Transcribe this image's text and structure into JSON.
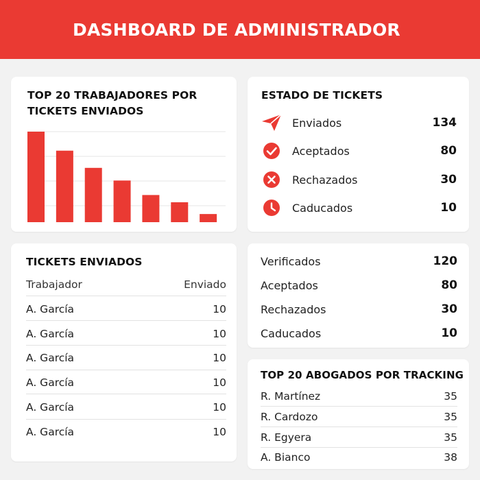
{
  "header": {
    "title": "DASHBOARD DE ADMINISTRADOR"
  },
  "colors": {
    "accent": "#ea3a33",
    "background": "#f2f2f2",
    "card": "#ffffff"
  },
  "top_workers": {
    "title": "TOP 20 TRABAJADORES POR TICKETS ENVIADOS"
  },
  "chart_data": {
    "type": "bar",
    "title": "TOP 20 TRABAJADORES POR TICKETS ENVIADOS",
    "categories": [
      "",
      "",
      "",
      "",
      "",
      "",
      ""
    ],
    "values": [
      100,
      79,
      60,
      46,
      30,
      22,
      9
    ],
    "ylim": [
      0,
      100
    ],
    "grid": true,
    "legend": "none",
    "xlabel": "",
    "ylabel": "",
    "color": "#ea3a33"
  },
  "ticket_status": {
    "title": "ESTADO DE TICKETS",
    "items": [
      {
        "label": "Enviados",
        "value": "134",
        "icon": "send-icon"
      },
      {
        "label": "Aceptados",
        "value": "80",
        "icon": "check-circle-icon"
      },
      {
        "label": "Rechazados",
        "value": "30",
        "icon": "x-circle-icon"
      },
      {
        "label": "Caducados",
        "value": "10",
        "icon": "clock-icon"
      }
    ]
  },
  "tickets_sent": {
    "title": "TICKETS ENVIADOS",
    "columns": [
      "Trabajador",
      "Enviado"
    ],
    "rows": [
      {
        "name": "A. García",
        "sent": "10"
      },
      {
        "name": "A. García",
        "sent": "10"
      },
      {
        "name": "A. García",
        "sent": "10"
      },
      {
        "name": "A. García",
        "sent": "10"
      },
      {
        "name": "A. García",
        "sent": "10"
      },
      {
        "name": "A. García",
        "sent": "10"
      }
    ]
  },
  "summary": {
    "items": [
      {
        "label": "Verificados",
        "value": "120"
      },
      {
        "label": "Aceptados",
        "value": "80"
      },
      {
        "label": "Rechazados",
        "value": "30"
      },
      {
        "label": "Caducados",
        "value": "10"
      }
    ]
  },
  "top_lawyers": {
    "title": "TOP 20 ABOGADOS POR TRACKING",
    "rows": [
      {
        "name": "R. Martínez",
        "value": "35"
      },
      {
        "name": "R. Cardozo",
        "value": "35"
      },
      {
        "name": "R. Egyera",
        "value": "35"
      },
      {
        "name": "A. Bianco",
        "value": "38"
      }
    ]
  }
}
